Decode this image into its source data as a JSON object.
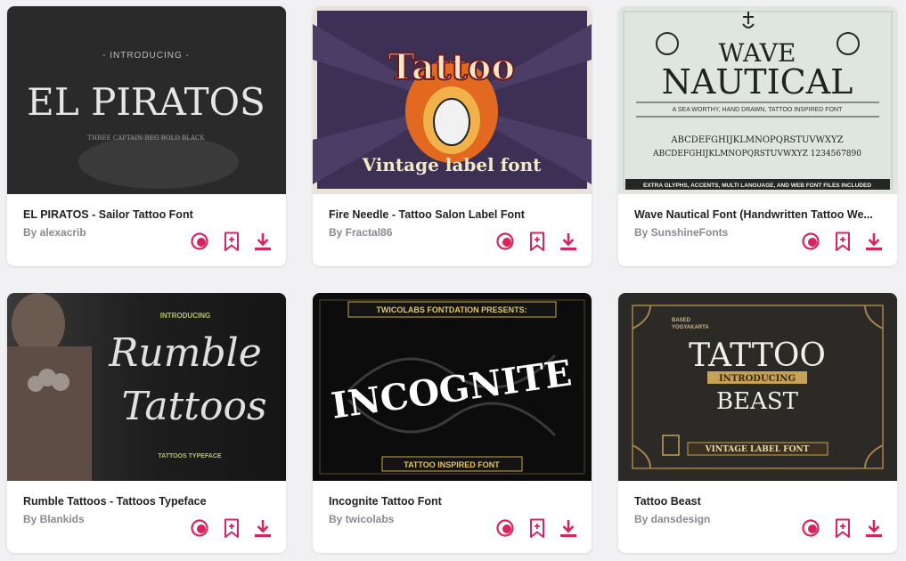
{
  "colors": {
    "accent": "#d6245c",
    "title": "#222222",
    "author": "#8a8a95",
    "background": "#f1f1f4"
  },
  "cards": [
    {
      "title": "EL PIRATOS - Sailor Tattoo Font",
      "author": "By alexacrib",
      "thumb": {
        "intro": "- INTRODUCING -",
        "headline": "EL PIRATOS",
        "sub": "THREE CAPTAIN REG BOLD BLACK"
      }
    },
    {
      "title": "Fire Needle - Tattoo Salon Label Font",
      "author": "By Fractal86",
      "thumb": {
        "headline": "Tattoo",
        "sub": "Vintage label font"
      }
    },
    {
      "title": "Wave Nautical Font (Handwritten Tattoo We...",
      "author": "By SunshineFonts",
      "thumb": {
        "headline1": "WAVE",
        "headline2": "NAUTICAL",
        "tagline": "A SEA WORTHY, HAND DRAWN, TATTOO INSPIRED FONT",
        "alphabet1": "ABCDEFGHIJKLMNOPQRSTUVWXYZ",
        "alphabet2": "ABCDEFGHIJKLMNOPQRSTUVWXYZ 1234567890",
        "footer": "EXTRA GLYPHS, ACCENTS, MULTI LANGUAGE, AND WEB FONT FILES INCLUDED"
      }
    },
    {
      "title": "Rumble Tattoos - Tattoos Typeface",
      "author": "By Blankids",
      "thumb": {
        "intro": "INTRODUCING",
        "headline1": "Rumble",
        "headline2": "Tattoos",
        "sub": "TATTOOS TYPEFACE"
      }
    },
    {
      "title": "Incognite Tattoo Font",
      "author": "By twicolabs",
      "thumb": {
        "banner": "TWICOLABS FONTDATION PRESENTS:",
        "headline": "INCOGNITE",
        "footer": "TATTOO INSPIRED FONT"
      }
    },
    {
      "title": "Tattoo Beast",
      "author": "By dansdesign",
      "thumb": {
        "corner1": "BASED",
        "corner2": "YOGYAKARTA",
        "headline1": "TATTOO",
        "ribbon": "INTRODUCING",
        "headline2": "BEAST",
        "footer": "VINTAGE LABEL FONT"
      }
    }
  ]
}
